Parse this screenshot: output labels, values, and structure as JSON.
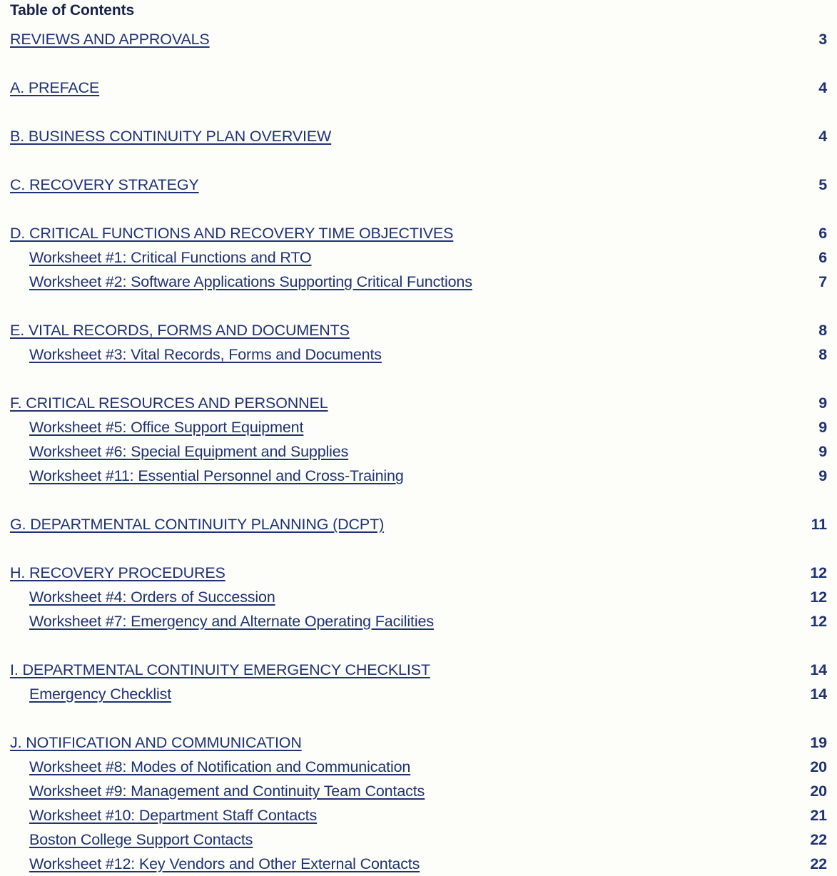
{
  "document": {
    "title": "Table of Contents",
    "link_color": "#1f3273",
    "title_color": "#17214a",
    "leader_color": "#141414",
    "background_color": "#fdfdfa"
  },
  "entries": [
    {
      "label": "REVIEWS AND APPROVALS",
      "page": "3",
      "level": 1,
      "gap_before": false,
      "leader_space": true
    },
    {
      "label": "A. PREFACE",
      "page": "4",
      "level": 1,
      "gap_before": true,
      "leader_space": true
    },
    {
      "label": "B. BUSINESS CONTINUITY PLAN OVERVIEW",
      "page": "4",
      "level": 1,
      "gap_before": true,
      "leader_space": true
    },
    {
      "label": "C. RECOVERY STRATEGY",
      "page": "5",
      "level": 1,
      "gap_before": true,
      "leader_space": true
    },
    {
      "label": "D. CRITICAL FUNCTIONS AND RECOVERY TIME OBJECTIVES",
      "page": "6",
      "level": 1,
      "gap_before": true,
      "leader_space": true
    },
    {
      "label": "Worksheet #1: Critical Functions and RTO",
      "page": "6",
      "level": 2,
      "gap_before": false,
      "leader_space": true
    },
    {
      "label": "Worksheet #2: Software Applications Supporting Critical Functions",
      "page": "7",
      "level": 2,
      "gap_before": false,
      "leader_space": false
    },
    {
      "label": "E. VITAL RECORDS, FORMS AND DOCUMENTS",
      "page": "8",
      "level": 1,
      "gap_before": true,
      "leader_space": false
    },
    {
      "label": "Worksheet #3: Vital Records, Forms and Documents",
      "page": "8",
      "level": 2,
      "gap_before": false,
      "leader_space": true
    },
    {
      "label": "F. CRITICAL RESOURCES AND PERSONNEL",
      "page": "9",
      "level": 1,
      "gap_before": true,
      "leader_space": false
    },
    {
      "label": "Worksheet #5: Office Support Equipment",
      "page": "9",
      "level": 2,
      "gap_before": false,
      "leader_space": false
    },
    {
      "label": "Worksheet #6: Special Equipment and Supplies",
      "page": "9",
      "level": 2,
      "gap_before": false,
      "leader_space": true
    },
    {
      "label": "Worksheet #11: Essential Personnel and Cross-Training",
      "page": "9",
      "level": 2,
      "gap_before": false,
      "leader_space": true
    },
    {
      "label": "G. DEPARTMENTAL CONTINUITY PLANNING (DCPT)",
      "page": "11",
      "level": 1,
      "gap_before": true,
      "leader_space": false
    },
    {
      "label": "H. RECOVERY PROCEDURES",
      "page": "12",
      "level": 1,
      "gap_before": true,
      "leader_space": false
    },
    {
      "label": "Worksheet #4: Orders of Succession",
      "page": "12",
      "level": 2,
      "gap_before": false,
      "leader_space": false
    },
    {
      "label": "Worksheet #7: Emergency and Alternate Operating Facilities",
      "page": "12",
      "level": 2,
      "gap_before": false,
      "leader_space": false
    },
    {
      "label": "I. DEPARTMENTAL CONTINUITY EMERGENCY CHECKLIST",
      "page": "14",
      "level": 1,
      "gap_before": true,
      "leader_space": true
    },
    {
      "label": "Emergency Checklist",
      "page": "14",
      "level": 2,
      "gap_before": false,
      "leader_space": false
    },
    {
      "label": "J. NOTIFICATION AND COMMUNICATION",
      "page": "19",
      "level": 1,
      "gap_before": true,
      "leader_space": true
    },
    {
      "label": "Worksheet #8: Modes of Notification and Communication",
      "page": "20",
      "level": 2,
      "gap_before": false,
      "leader_space": false
    },
    {
      "label": "Worksheet #9: Management and Continuity Team Contacts",
      "page": "20",
      "level": 2,
      "gap_before": false,
      "leader_space": true
    },
    {
      "label": "Worksheet #10: Department Staff Contacts",
      "page": "21",
      "level": 2,
      "gap_before": false,
      "leader_space": true
    },
    {
      "label": "Boston College Support Contacts",
      "page": "22",
      "level": 2,
      "gap_before": false,
      "leader_space": true
    },
    {
      "label": "Worksheet #12: Key Vendors and Other External Contacts",
      "page": "22",
      "level": 2,
      "gap_before": false,
      "leader_space": false
    }
  ]
}
